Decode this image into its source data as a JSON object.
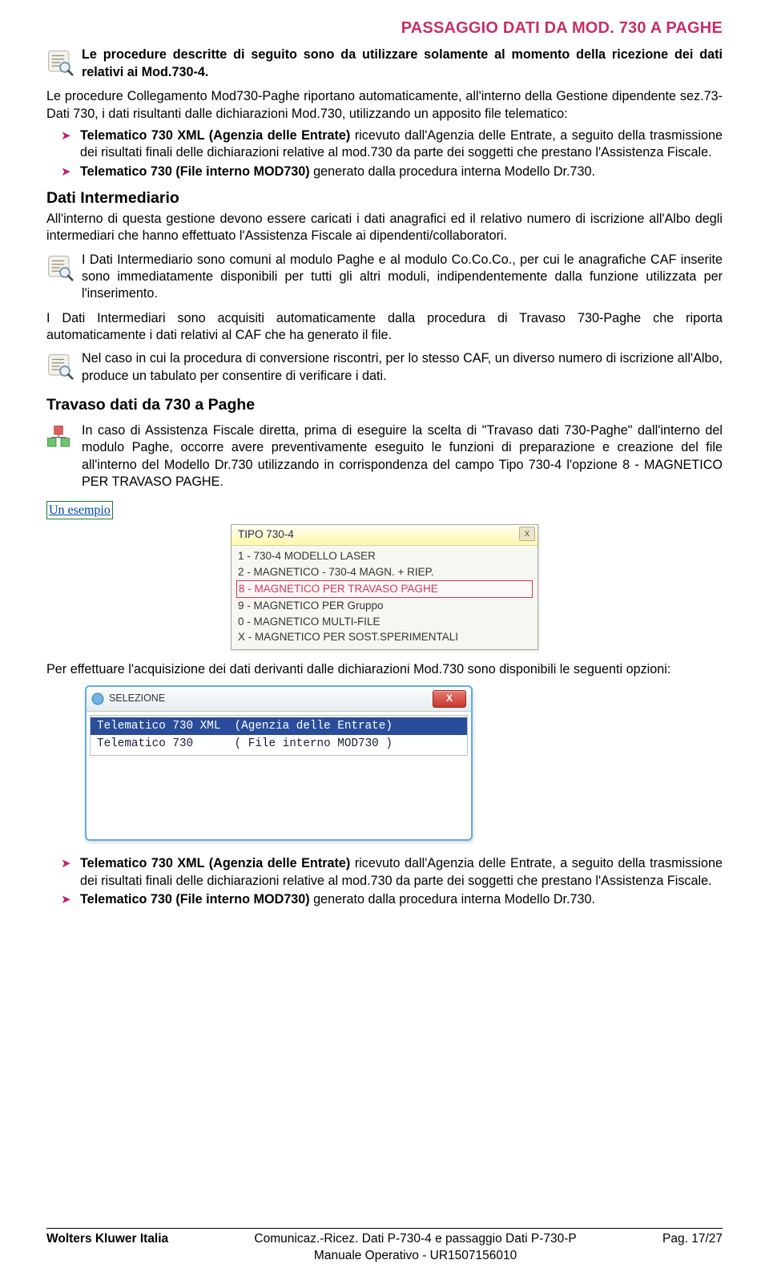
{
  "header": {
    "title": "PASSAGGIO DATI DA MOD. 730 A PAGHE"
  },
  "intro": {
    "bold": "Le procedure descritte di seguito sono da utilizzare solamente al momento della ricezione dei dati relativi ai Mod.730-4.",
    "plain": "Le procedure Collegamento Mod730-Paghe riportano automaticamente, all'interno della Gestione dipendente sez.73-Dati 730, i dati risultanti dalle dichiarazioni Mod.730, utilizzando un apposito file telematico:"
  },
  "bullets1": [
    {
      "b": "Telematico 730 XML (Agenzia delle Entrate)",
      "rest": " ricevuto dall'Agenzia delle Entrate, a seguito della trasmissione dei risultati finali delle dichiarazioni relative al mod.730 da parte dei soggetti che prestano l'Assistenza Fiscale."
    },
    {
      "b": "Telematico 730 (File interno MOD730)",
      "rest": " generato dalla procedura interna Modello Dr.730."
    }
  ],
  "sec_inter": {
    "title": "Dati Intermediario",
    "p1": "All'interno di questa gestione devono essere caricati i dati anagrafici ed il relativo numero di iscrizione all'Albo degli intermediari che hanno effettuato l'Assistenza Fiscale ai dipendenti/collaboratori.",
    "note1": "I Dati Intermediario sono comuni al modulo Paghe e al modulo Co.Co.Co., per cui le anagrafiche CAF inserite sono immediatamente disponibili per tutti gli altri moduli, indipendentemente dalla funzione utilizzata per l'inserimento.",
    "p2": "I Dati Intermediari sono acquisiti automaticamente dalla procedura di Travaso 730-Paghe che riporta automaticamente i dati relativi al CAF che ha generato il file.",
    "note2": "Nel caso in cui la procedura di conversione riscontri, per lo stesso CAF, un diverso numero di iscrizione all'Albo, produce un tabulato per consentire di verificare i dati."
  },
  "sec_travaso": {
    "title": "Travaso dati da 730 a Paghe",
    "note": "In caso di Assistenza Fiscale diretta, prima di eseguire la scelta di \"Travaso dati 730-Paghe\" dall'interno del modulo Paghe, occorre avere preventivamente eseguito le funzioni di preparazione e creazione del file all'interno del Modello Dr.730 utilizzando in corrispondenza del campo Tipo 730-4 l'opzione 8 - MAGNETICO PER TRAVASO PAGHE.",
    "example_link": "Un esempio"
  },
  "dropdown": {
    "title": "TIPO 730-4",
    "rows": [
      "1 - 730-4 MODELLO LASER",
      "2 - MAGNETICO - 730-4 MAGN. + RIEP.",
      "8 - MAGNETICO PER TRAVASO PAGHE",
      "9 - MAGNETICO PER Gruppo",
      "0 - MAGNETICO MULTI-FILE",
      "X - MAGNETICO PER SOST.SPERIMENTALI"
    ],
    "selected_index": 2,
    "close": "x"
  },
  "acq_opts_intro": "Per effettuare l'acquisizione dei dati derivanti dalle dichiarazioni Mod.730 sono disponibili le seguenti opzioni:",
  "selezione": {
    "title": "SELEZIONE",
    "close": "X",
    "rows": [
      "Telematico 730 XML  (Agenzia delle Entrate)",
      "Telematico 730      ( File interno MOD730 )"
    ],
    "highlight_index": 0
  },
  "bullets2": [
    {
      "b": "Telematico 730 XML (Agenzia delle Entrate)",
      "rest": " ricevuto dall'Agenzia delle Entrate, a seguito della trasmissione dei risultati finali delle dichiarazioni relative al mod.730 da parte dei soggetti che prestano l'Assistenza Fiscale."
    },
    {
      "b": "Telematico 730 (File interno MOD730)",
      "rest": " generato dalla procedura interna Modello Dr.730."
    }
  ],
  "footer": {
    "left": "Wolters Kluwer Italia",
    "center_l1": "Comunicaz.-Ricez. Dati P-730-4 e passaggio Dati P-730-P",
    "center_l2": "Manuale Operativo - UR1507156010",
    "right": "Pag. 17/27"
  }
}
